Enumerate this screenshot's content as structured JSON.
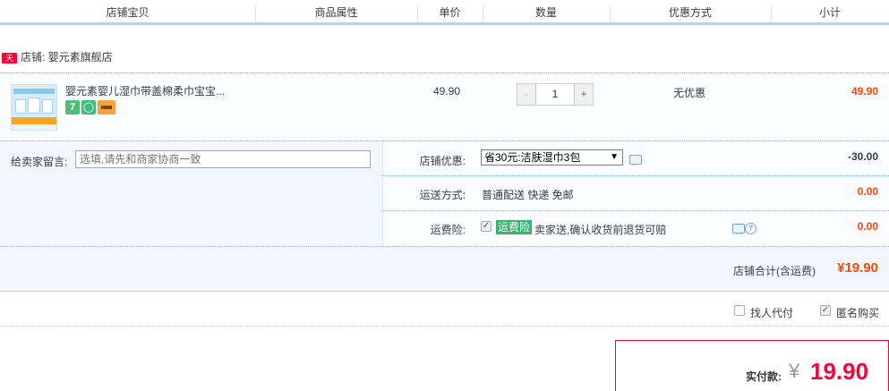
{
  "header": {
    "columns": [
      "店铺宝贝",
      "商品属性",
      "单价",
      "数量",
      "优惠方式",
      "小计"
    ]
  },
  "shop": {
    "badge": "天猫",
    "name": "店铺: 婴元素旗舰店"
  },
  "item": {
    "title": "婴元素婴儿湿巾带盖棉柔巾宝宝...",
    "icons": [
      "seven-days-icon",
      "bag-icon",
      "card-icon"
    ],
    "icon_seven": "7",
    "price": "49.90",
    "quantity": "1",
    "minus": "-",
    "plus": "+",
    "discount": "无优惠",
    "subtotal": "49.90"
  },
  "message": {
    "label": "给卖家留言:",
    "placeholder": "选填,请先和商家协商一致"
  },
  "options": {
    "coupon_label": "店铺优惠:",
    "coupon_value": "省30元:洁肤湿巾3包",
    "coupon_amount": "-30.00",
    "shipping_label": "运送方式:",
    "shipping_value": "普通配送 快递 免邮",
    "shipping_amount": "0.00",
    "insurance_label": "运费险:",
    "insurance_tag": "运费险",
    "insurance_text": "卖家送,确认收货前退货可赔",
    "insurance_amount": "0.00",
    "insurance_checked": true
  },
  "shop_total": {
    "label": "店铺合计(含运费)",
    "amount": "¥19.90"
  },
  "agent": {
    "proxy_label": "找人代付",
    "proxy_checked": false,
    "anon_label": "匿名购买",
    "anon_checked": true
  },
  "payment": {
    "label": "实付款:",
    "currency": "¥",
    "amount": "19.90"
  },
  "colors": {
    "accent_red": "#ff0036",
    "price_orange": "#ff4400",
    "header_border": "#b2d1ff",
    "option_bg": "#f2f7ff"
  }
}
